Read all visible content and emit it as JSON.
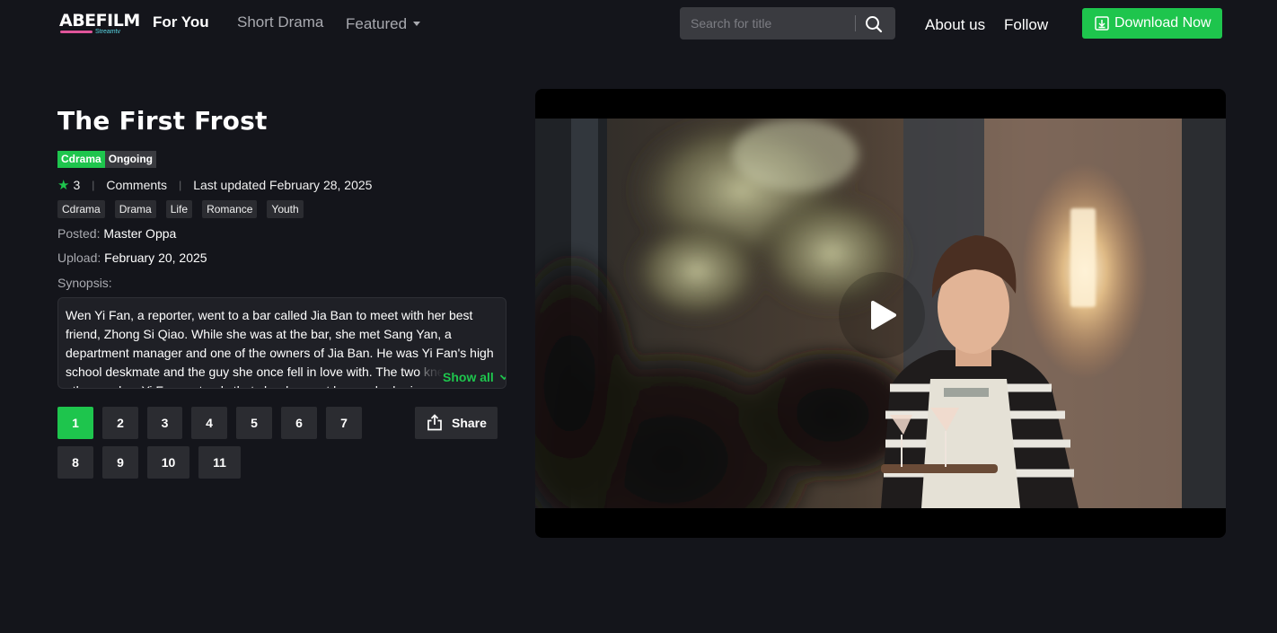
{
  "header": {
    "logo_text": "ABEFILM",
    "logo_subtext": "Streamtv",
    "nav": {
      "for_you": "For You",
      "short_drama": "Short Drama",
      "featured": "Featured"
    },
    "search_placeholder": "Search for title",
    "about": "About us",
    "follow": "Follow",
    "download": "Download Now"
  },
  "show": {
    "title": "The First Frost",
    "type_badge": "Cdrama",
    "status_badge": "Ongoing",
    "rating": "3",
    "comments": "Comments",
    "last_updated": "Last updated February 28, 2025",
    "genres": [
      "Cdrama",
      "Drama",
      "Life",
      "Romance",
      "Youth"
    ],
    "posted_label": "Posted:",
    "posted_value": "Master Oppa",
    "upload_label": "Upload:",
    "upload_value": "February 20, 2025",
    "synopsis_label": "Synopsis:",
    "synopsis": "Wen Yi Fan, a reporter, went to a bar called Jia Ban to meet with her best friend, Zhong Si Qiao. While she was at the bar, she met Sang Yan, a department manager and one of the owners of Jia Ban. He was Yi Fan's high school deskmate and the guy she once fell in love with. The two knew each other, and so Yi Fan pretends that she does not know who he is.",
    "show_all": "Show all"
  },
  "episodes": [
    "1",
    "2",
    "3",
    "4",
    "5",
    "6",
    "7",
    "8",
    "9",
    "10",
    "11"
  ],
  "active_episode": "1",
  "share_label": "Share",
  "colors": {
    "accent": "#1ec54d",
    "background": "#14151b",
    "chip": "#2b2c31"
  }
}
